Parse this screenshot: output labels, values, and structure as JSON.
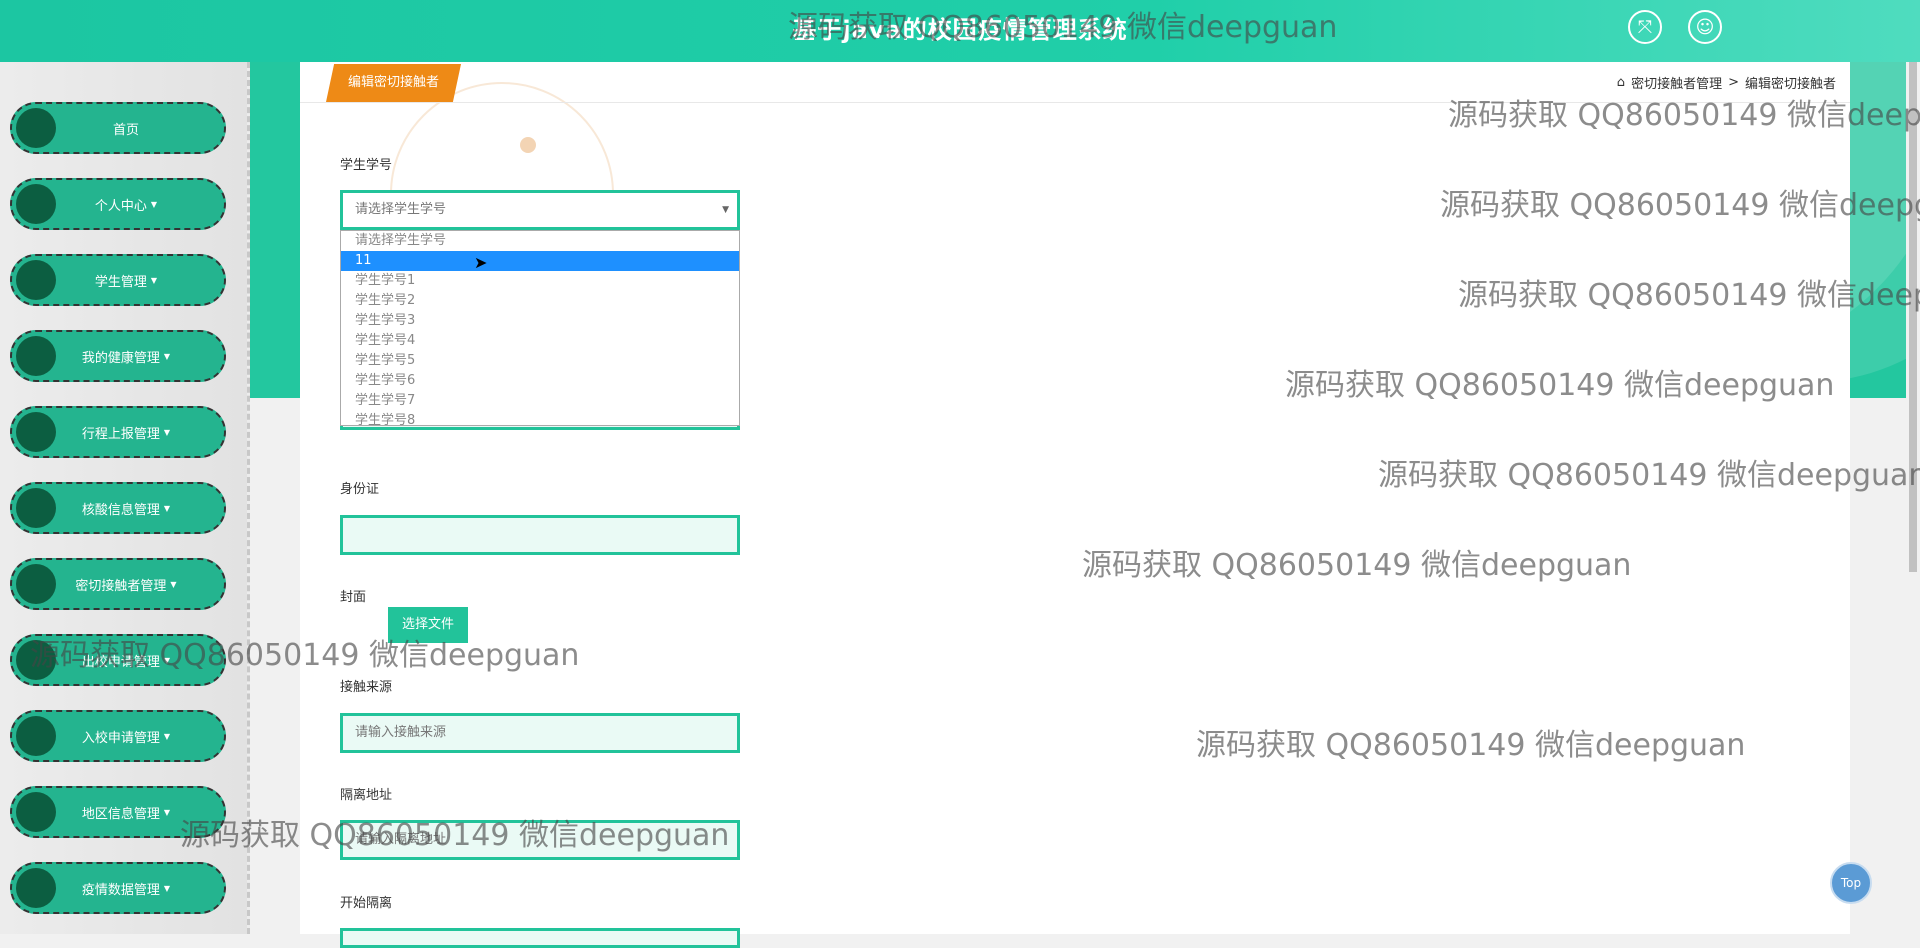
{
  "header": {
    "title": "基于java的校园疫情管理系统",
    "fullscreen_icon": "expand-icon",
    "user_icon": "user-icon"
  },
  "sidebar": {
    "items": [
      {
        "label": "首页",
        "has_caret": false
      },
      {
        "label": "个人中心",
        "has_caret": true
      },
      {
        "label": "学生管理",
        "has_caret": true
      },
      {
        "label": "我的健康管理",
        "has_caret": true
      },
      {
        "label": "行程上报管理",
        "has_caret": true
      },
      {
        "label": "核酸信息管理",
        "has_caret": true
      },
      {
        "label": "密切接触者管理",
        "has_caret": true
      },
      {
        "label": "出校申请管理",
        "has_caret": true
      },
      {
        "label": "入校申请管理",
        "has_caret": true
      },
      {
        "label": "地区信息管理",
        "has_caret": true
      },
      {
        "label": "疫情数据管理",
        "has_caret": true
      }
    ]
  },
  "page": {
    "tab_label": "编辑密切接触者",
    "breadcrumb": {
      "parent": "密切接触者管理",
      "separator": ">",
      "current": "编辑密切接触者"
    }
  },
  "form": {
    "student_id": {
      "label": "学生学号",
      "placeholder": "请选择学生学号",
      "options": [
        "请选择学生学号",
        "11",
        "学生学号1",
        "学生学号2",
        "学生学号3",
        "学生学号4",
        "学生学号5",
        "学生学号6",
        "学生学号7",
        "学生学号8"
      ],
      "highlighted": "11"
    },
    "id_card": {
      "label": "身份证",
      "value": ""
    },
    "cover": {
      "label": "封面",
      "button": "选择文件"
    },
    "contact_source": {
      "label": "接触来源",
      "placeholder": "请输入接触来源"
    },
    "quarantine_address": {
      "label": "隔离地址",
      "placeholder": "请输入隔离地址"
    },
    "start_quarantine": {
      "label": "开始隔离"
    }
  },
  "top_button": "Top",
  "watermark": "源码获取 QQ86050149 微信deepguan",
  "colors": {
    "accent": "#22c39a",
    "tab": "#ee8a16",
    "selected": "#1e90ff"
  }
}
